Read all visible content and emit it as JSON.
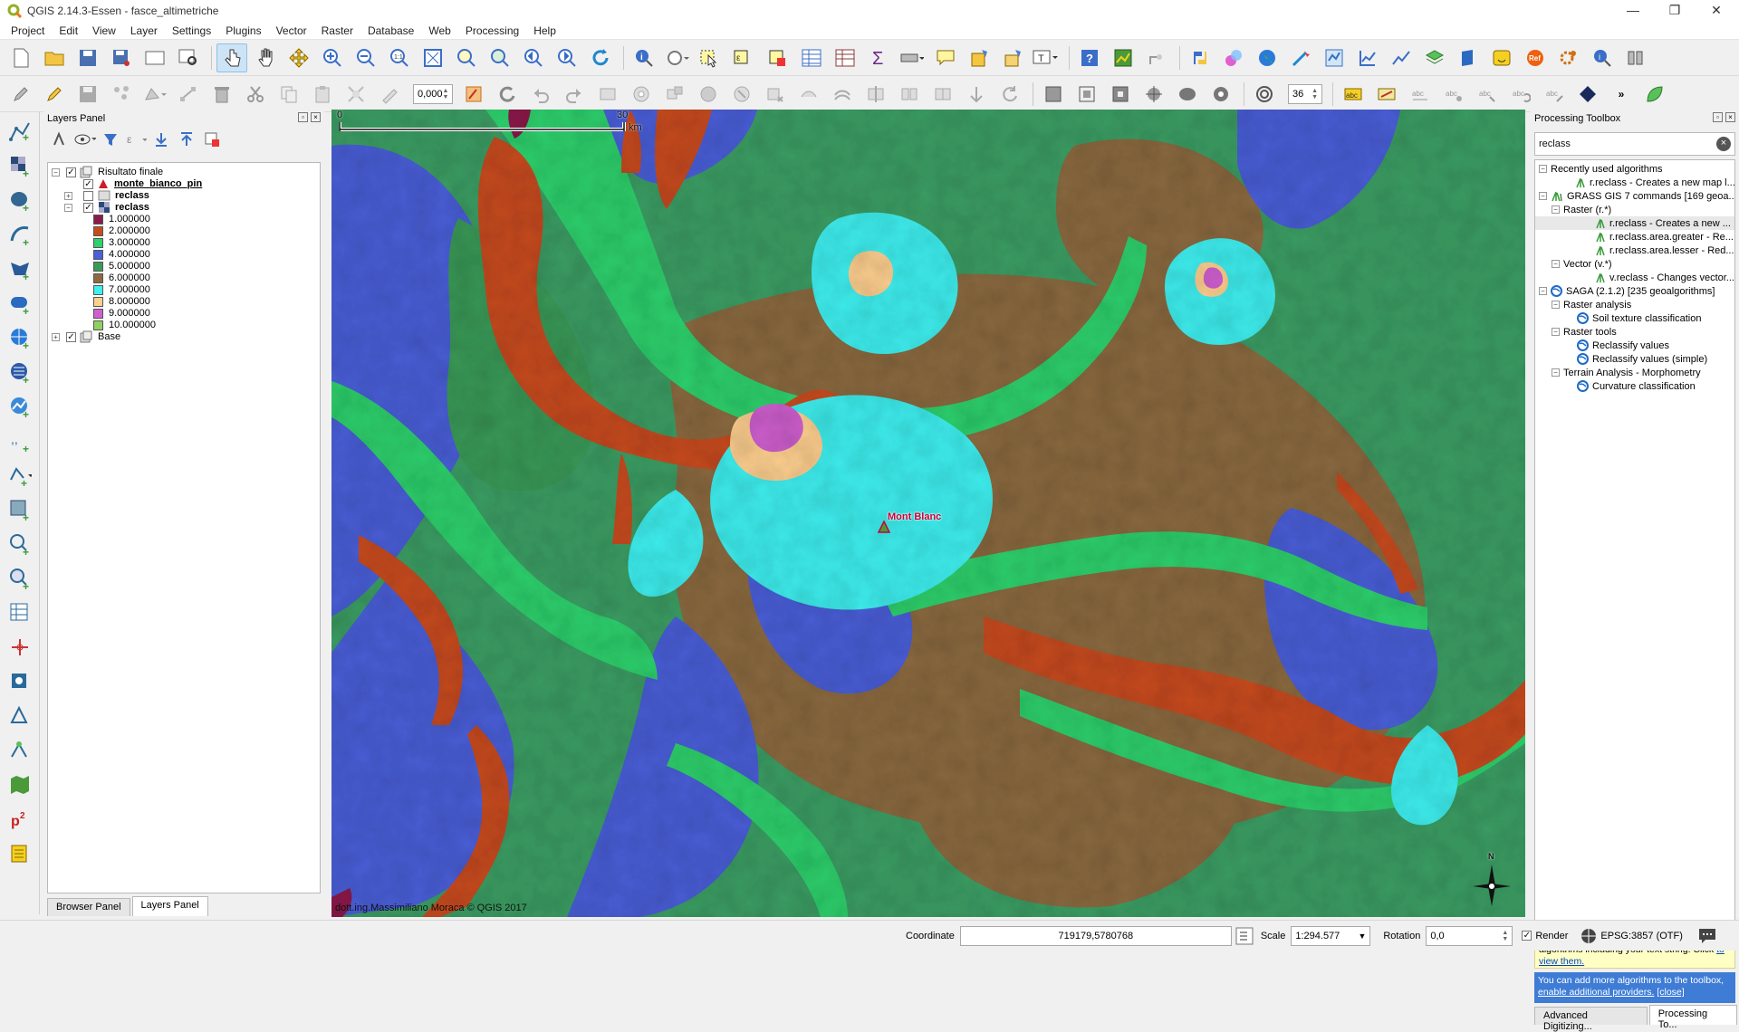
{
  "window": {
    "title": "QGIS 2.14.3-Essen - fasce_altimetriche"
  },
  "menu": [
    "Project",
    "Edit",
    "View",
    "Layer",
    "Settings",
    "Plugins",
    "Vector",
    "Raster",
    "Database",
    "Web",
    "Processing",
    "Help"
  ],
  "toolbar": {
    "rotation_value": "0,000",
    "label_size": "36"
  },
  "layers_panel": {
    "title": "Layers Panel",
    "groups": {
      "result_group": "Risultato finale",
      "base_group": "Base"
    },
    "layers": {
      "pin_layer": "monte_bianco_pin",
      "reclass_1": "reclass",
      "reclass_2": "reclass"
    },
    "legend": [
      {
        "label": "1.000000",
        "color": "#8b1a4a"
      },
      {
        "label": "2.000000",
        "color": "#c84b1e"
      },
      {
        "label": "3.000000",
        "color": "#2ed16d"
      },
      {
        "label": "4.000000",
        "color": "#4a5fd8"
      },
      {
        "label": "5.000000",
        "color": "#3a9a58"
      },
      {
        "label": "6.000000",
        "color": "#8b6a40"
      },
      {
        "label": "7.000000",
        "color": "#3ff0f0"
      },
      {
        "label": "8.000000",
        "color": "#ffd090"
      },
      {
        "label": "9.000000",
        "color": "#d060d0"
      },
      {
        "label": "10.000000",
        "color": "#90d060"
      }
    ],
    "tabs": {
      "browser": "Browser Panel",
      "layers": "Layers Panel"
    }
  },
  "map": {
    "scale_start": "0",
    "scale_end": "30",
    "scale_unit": "km",
    "credit": "dott.ing.Massimiliano Moraca © QGIS 2017",
    "peak_label": "Mont Blanc",
    "north_label": "N"
  },
  "processing": {
    "title": "Processing Toolbox",
    "search_value": "reclass",
    "tree": {
      "recent": "Recently used algorithms",
      "recent_rreclass": "r.reclass - Creates a new map l...",
      "grass": "GRASS GIS 7 commands [169 geoa...",
      "raster": "Raster (r.*)",
      "grass_rreclass": "r.reclass - Creates a new ...",
      "area_greater": "r.reclass.area.greater - Re...",
      "area_lesser": "r.reclass.area.lesser - Red...",
      "vector": "Vector (v.*)",
      "vreclass": "v.reclass - Changes vector...",
      "saga": "SAGA (2.1.2) [235 geoalgorithms]",
      "raster_analysis": "Raster analysis",
      "soil": "Soil texture classification",
      "raster_tools": "Raster tools",
      "reclassify": "Reclassify values",
      "reclassify_simple": "Reclassify values (simple)",
      "terrain": "Terrain Analysis - Morphometry",
      "curvature": "Curvature classification"
    },
    "warning_text": "There are disabled providers that contain algorithms including your text string. Click",
    "warning_link": "to view them.",
    "info_text": "You can add more algorithms to the toolbox,",
    "info_link": "enable additional providers.",
    "info_close": "[close]",
    "tabs": {
      "advanced": "Advanced Digitizing...",
      "processing": "Processing To..."
    }
  },
  "status": {
    "coordinate_label": "Coordinate",
    "coordinate_value": "719179,5780768",
    "scale_label": "Scale",
    "scale_value": "1:294.577",
    "rotation_label": "Rotation",
    "rotation_value": "0,0",
    "render_label": "Render",
    "crs": "EPSG:3857 (OTF)"
  }
}
